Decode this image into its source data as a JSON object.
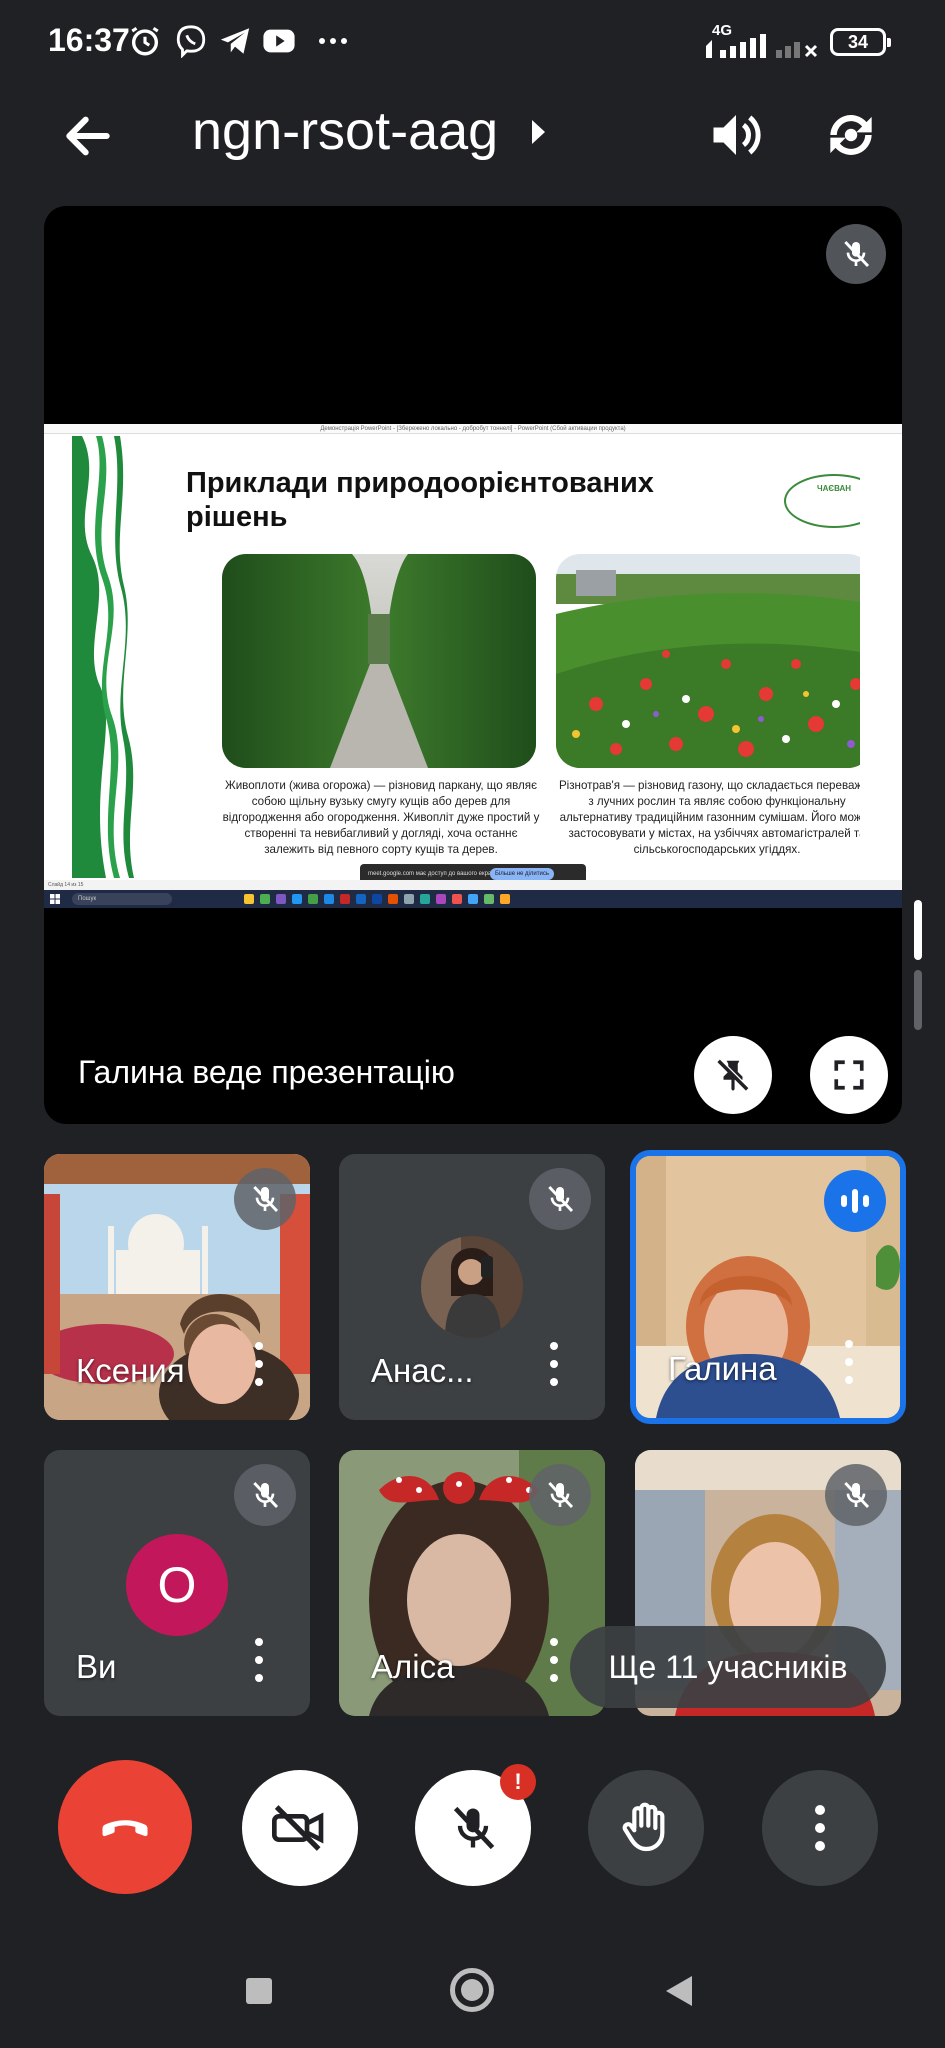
{
  "status_bar": {
    "time": "16:37",
    "network": "4G",
    "battery": "34",
    "icons": [
      "alarm-icon",
      "viber-icon",
      "telegram-icon",
      "youtube-icon",
      "more-dots-icon",
      "signal-icon",
      "signal-off-icon"
    ]
  },
  "top_bar": {
    "meeting_code": "ngn-rsot-aag",
    "icons": [
      "back-arrow-icon",
      "chevron-right-icon",
      "speaker-icon",
      "rotate-camera-icon"
    ]
  },
  "presentation": {
    "window_title": "Демонстрація PowerPoint - [Збережено локально - добробут тоннелі] - PowerPoint (Сбой активации продукта)",
    "slide_title": "Приклади природоорієнтованих рішень",
    "logo_text": "ЧАЄВАН",
    "caption_left": "Живоплоти (жива огорожа) — різновид паркану, що являє собою щільну вузьку смугу кущів або дерев для відгородження або огородження. Живопліт дуже простий у створенні та невибагливий у догляді, хоча останнє залежить від певного сорту кущів та дерев.",
    "caption_right": "Різнотрав'я — різновид газону, що складається переважно з лучних рослин та являє собою функціональну альтернативу традиційним газонним сумішам. Його можна застосовувати у містах, на узбіччях автомагістралей та сільськогосподарських угіддях.",
    "share_notice": "meet.google.com має доступ до вашого екрана",
    "share_stop": "Більше не ділитись",
    "slide_status": "Слайд 14 из 15",
    "taskbar_search": "Пошук",
    "presenter_label": "Галина веде презентацію",
    "colors": {
      "slide_green": "#1f8a3b",
      "accent_blue": "#1a73e8"
    }
  },
  "participants": [
    {
      "name": "Ксения",
      "muted": true
    },
    {
      "name": "Анас...",
      "muted": true
    },
    {
      "name": "Галина",
      "muted": false,
      "speaking": true
    },
    {
      "name": "Ви",
      "muted": true,
      "avatar_letter": "О"
    },
    {
      "name": "Аліса",
      "muted": true
    },
    {
      "name": "",
      "muted": true
    }
  ],
  "more_participants": "Ще 11 учасників",
  "controls": {
    "alert_badge": "!",
    "icons": [
      "end-call-icon",
      "camera-off-icon",
      "mic-off-icon",
      "raise-hand-icon",
      "more-vert-icon"
    ]
  },
  "nav_bar": {
    "icons": [
      "recents-icon",
      "home-icon",
      "back-icon"
    ]
  }
}
